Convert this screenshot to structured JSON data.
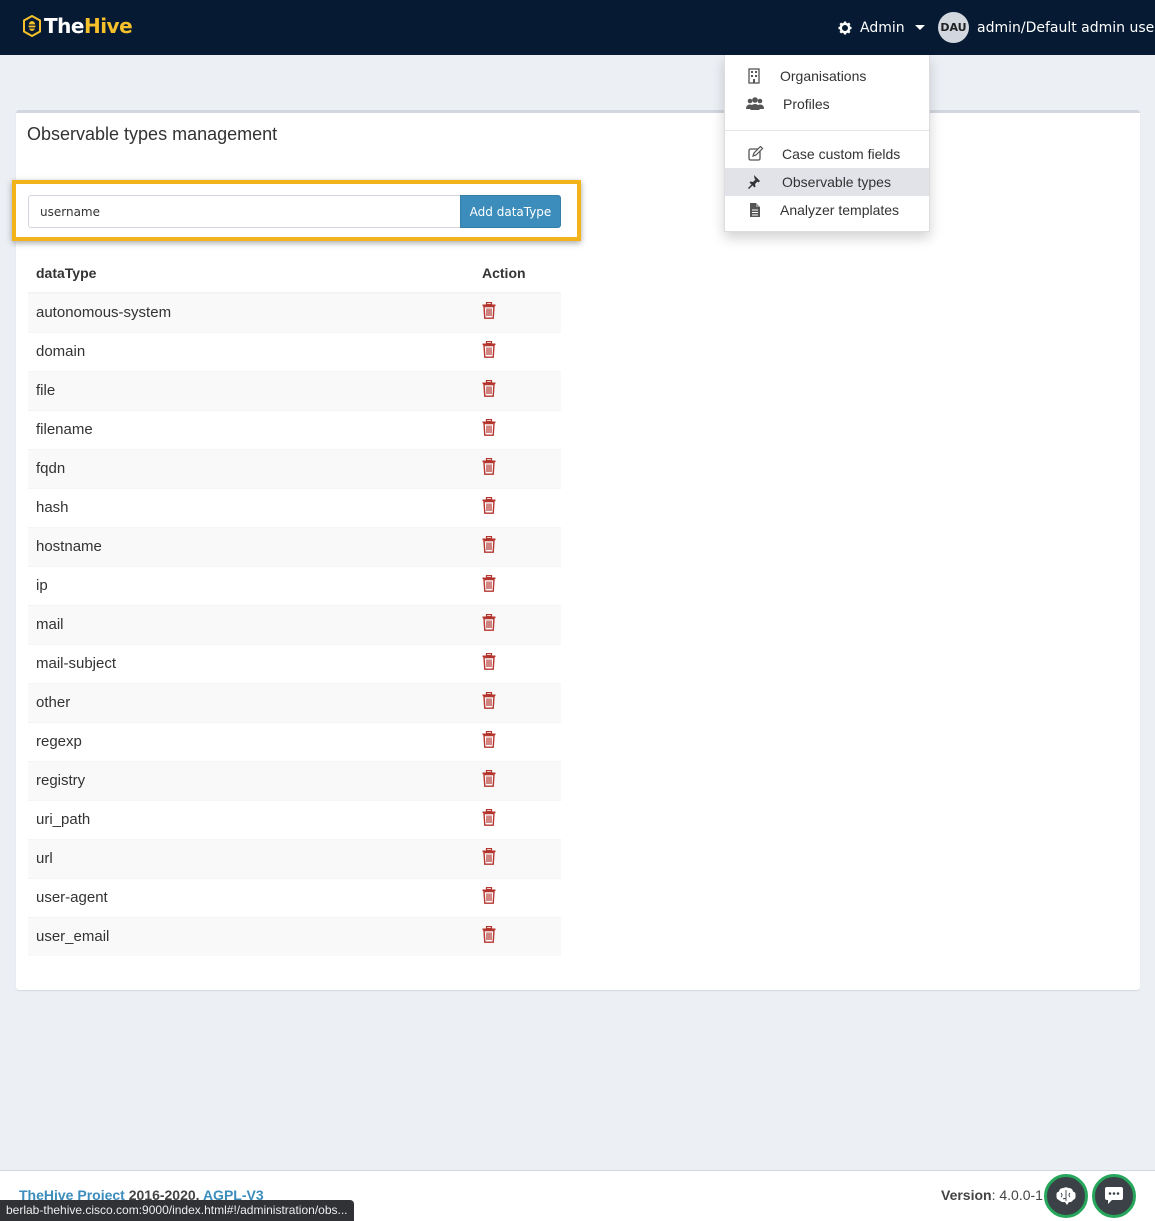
{
  "brand": {
    "name_part1": "The",
    "name_part2": "Hive"
  },
  "navbar": {
    "admin_label": "Admin",
    "user_initials": "DAU",
    "user_name": "admin/Default admin user"
  },
  "admin_dropdown": {
    "items": [
      {
        "label": "Organisations",
        "icon": "building-icon"
      },
      {
        "label": "Profiles",
        "icon": "users-icon"
      },
      {
        "label": "Case custom fields",
        "icon": "edit-icon"
      },
      {
        "label": "Observable types",
        "icon": "pin-icon",
        "active": true
      },
      {
        "label": "Analyzer templates",
        "icon": "file-icon"
      }
    ]
  },
  "page": {
    "title": "Observable types management",
    "input_value": "username",
    "add_button_label": "Add dataType",
    "highlight_color": "#f3b41b"
  },
  "table": {
    "headers": {
      "datatype": "dataType",
      "action": "Action"
    },
    "rows": [
      "autonomous-system",
      "domain",
      "file",
      "filename",
      "fqdn",
      "hash",
      "hostname",
      "ip",
      "mail",
      "mail-subject",
      "other",
      "regexp",
      "registry",
      "uri_path",
      "url",
      "user-agent",
      "user_email"
    ],
    "delete_icon_color": "#b5352f"
  },
  "footer": {
    "project_link": "TheHive Project",
    "years": " 2016-2020, ",
    "license_link": "AGPL-V3",
    "version_label": "Version",
    "version_value": ": 4.0.0-1"
  },
  "status_bar": {
    "url": "berlab-thehive.cisco.com:9000/index.html#!/administration/obs..."
  },
  "colors": {
    "navbar_bg": "#061b33",
    "brand_accent": "#f5c02a",
    "primary_button": "#3c8dbc",
    "fab_border": "#26a65b"
  }
}
